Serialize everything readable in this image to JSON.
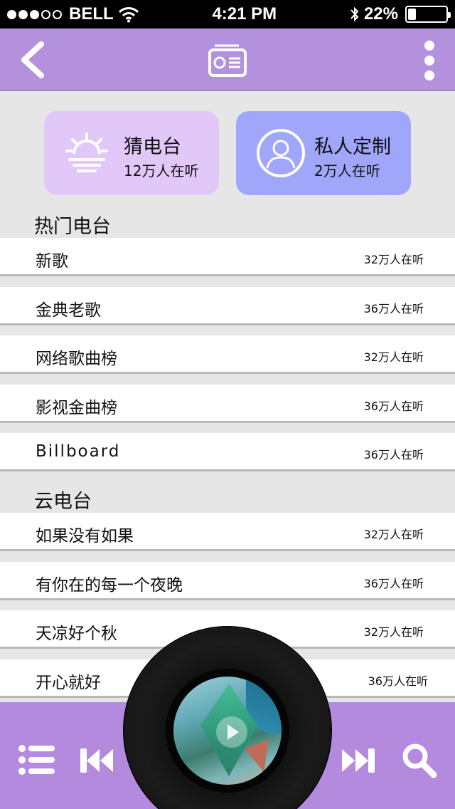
{
  "status": {
    "carrier": "BELL",
    "time": "4:21 PM",
    "battery": "22%",
    "battery_level": 0.22,
    "signal_bars_filled": 3,
    "signal_bars_total": 5
  },
  "header": {
    "back_icon": "chevron-left-icon",
    "center_icon": "radio-icon",
    "more_icon": "vertical-dots-icon"
  },
  "cards": [
    {
      "title": "猜电台",
      "subtitle": "12万人在听",
      "icon": "sunrise-icon",
      "color": "#e2c8f8"
    },
    {
      "title": "私人定制",
      "subtitle": "2万人在听",
      "icon": "user-avatar-icon",
      "color": "#a0a6fa"
    }
  ],
  "sections": [
    {
      "title": "热门电台",
      "items": [
        {
          "title": "新歌",
          "count": "32万人在听"
        },
        {
          "title": "金典老歌",
          "count": "36万人在听"
        },
        {
          "title": "网络歌曲榜",
          "count": "32万人在听"
        },
        {
          "title": "影视金曲榜",
          "count": "36万人在听"
        },
        {
          "title": "Billboard",
          "count": "36万人在听"
        }
      ]
    },
    {
      "title": "云电台",
      "items": [
        {
          "title": "如果没有如果",
          "count": "32万人在听"
        },
        {
          "title": "有你在的每一个夜晚",
          "count": "36万人在听"
        },
        {
          "title": "天凉好个秋",
          "count": "32万人在听"
        },
        {
          "title": "开心就好",
          "count": "36万人在听"
        }
      ]
    }
  ],
  "player": {
    "controls": [
      "playlist-icon",
      "previous-icon",
      "next-icon",
      "search-icon"
    ],
    "accent": "#b48ade"
  },
  "colors": {
    "header": "#b491dd",
    "background": "#e6e6e6"
  }
}
